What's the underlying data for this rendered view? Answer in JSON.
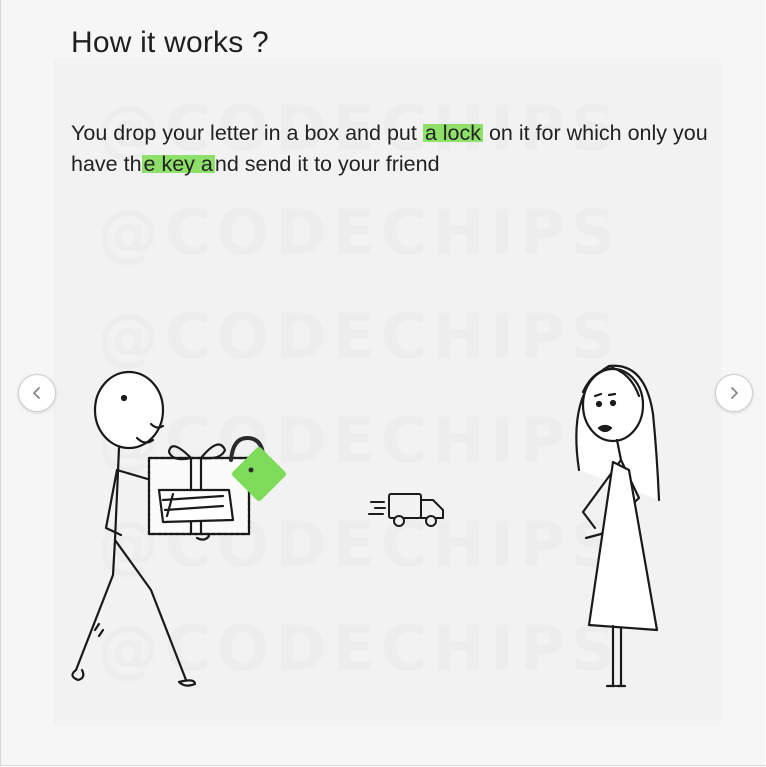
{
  "page": {
    "title": "How it works ?",
    "description": {
      "part1": "You drop your letter in a box and put ",
      "highlight1": "a lock",
      "part2": " on it for which only you have th",
      "highlight2": "e key a",
      "part3": "nd send it to your friend"
    },
    "watermark": "@CODECHIPS"
  },
  "nav": {
    "prev_icon": "chevron-left-icon",
    "next_icon": "chevron-right-icon"
  },
  "colors": {
    "highlight": "#8fe06a",
    "lock": "#7fdc5b",
    "ink": "#1a1a1a"
  }
}
